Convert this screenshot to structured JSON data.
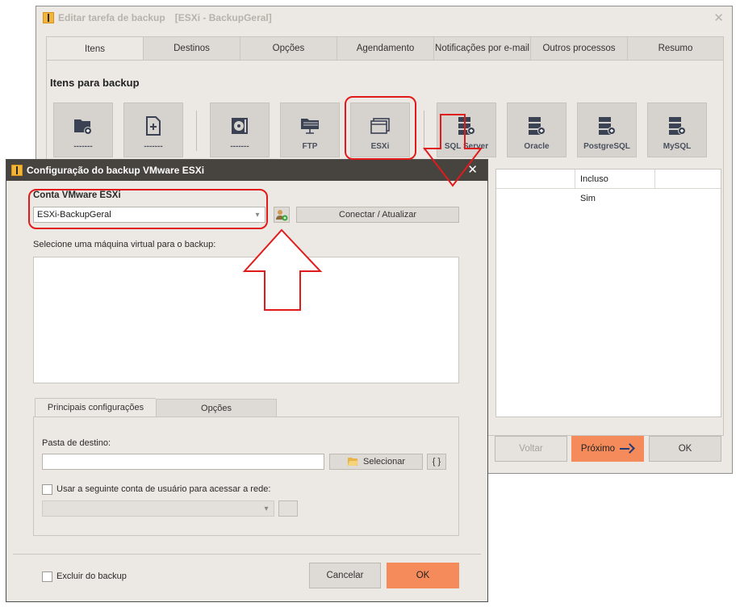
{
  "back_window": {
    "title": "Editar tarefa de backup",
    "title_task": "[ESXi - BackupGeral]",
    "tabs": [
      "Itens",
      "Destinos",
      "Opções",
      "Agendamento",
      "Notificações por e-mail",
      "Outros processos",
      "Resumo"
    ],
    "section_title": "Itens para backup",
    "tiles": [
      {
        "label": "-------",
        "icon": "folder-add-icon"
      },
      {
        "label": "-------",
        "icon": "file-add-icon"
      },
      {
        "label": "-------",
        "icon": "disk-icon"
      },
      {
        "label": "FTP",
        "icon": "ftp-folder-icon"
      },
      {
        "label": "ESXi",
        "icon": "esxi-window-icon"
      },
      {
        "label": "SQL Server",
        "icon": "database-add-icon"
      },
      {
        "label": "Oracle",
        "icon": "database-add-icon"
      },
      {
        "label": "PostgreSQL",
        "icon": "database-add-icon"
      },
      {
        "label": "MySQL",
        "icon": "database-add-icon"
      }
    ],
    "list_header_included": "Incluso",
    "list_row_value": "Sim",
    "buttons": {
      "back": "Voltar",
      "next": "Próximo",
      "ok": "OK"
    }
  },
  "dialog": {
    "title": "Configuração do backup VMware ESXi",
    "account_label": "Conta VMware ESXi",
    "account_value": "ESXi-BackupGeral",
    "connect_button": "Conectar / Atualizar",
    "vm_select_label": "Selecione uma máquina virtual para o backup:",
    "tabs": [
      "Principais configurações",
      "Opções"
    ],
    "dest_folder_label": "Pasta de destino:",
    "dest_folder_value": "",
    "select_button": "Selecionar",
    "braces_button": "{ }",
    "network_account_label": "Usar a seguinte conta de usuário para acessar a rede:",
    "exclude_label": "Excluir do backup",
    "cancel_button": "Cancelar",
    "ok_button": "OK"
  },
  "colors": {
    "accent": "#f58a5a",
    "highlight": "#e11b1b",
    "title_bar": "#47443f"
  }
}
